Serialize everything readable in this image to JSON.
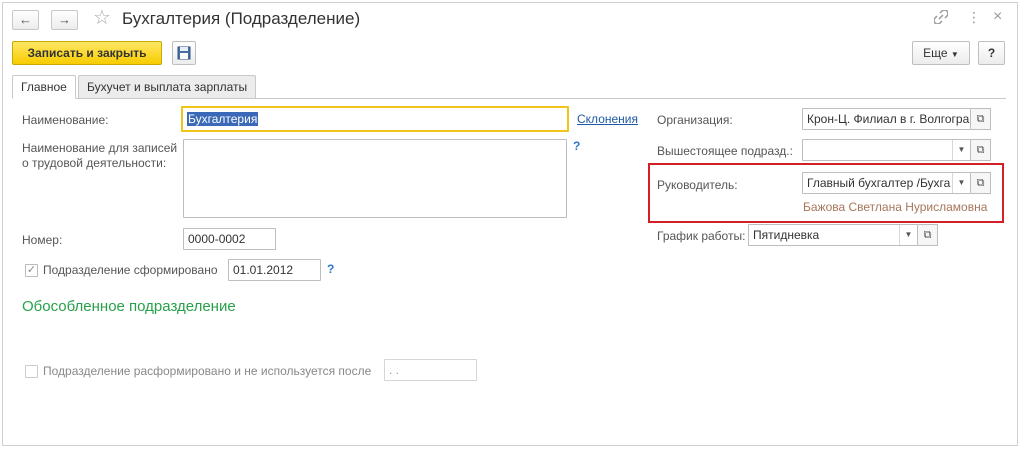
{
  "window": {
    "title": "Бухгалтерия (Подразделение)",
    "back_icon": "←",
    "forward_icon": "→",
    "star_icon": "☆",
    "link_icon": "🔗",
    "menu_icon": "⋮",
    "close_icon": "×"
  },
  "toolbar": {
    "save_close_label": "Записать и закрыть",
    "more_label": "Еще",
    "help_label": "?"
  },
  "tabs": [
    {
      "label": "Главное",
      "active": true
    },
    {
      "label": "Бухучет и выплата зарплаты",
      "active": false
    }
  ],
  "form": {
    "name_label": "Наименование:",
    "name_value": "Бухгалтерия",
    "declensions_link": "Склонения",
    "labor_name_label_line1": "Наименование для записей",
    "labor_name_label_line2": "о трудовой деятельности:",
    "labor_name_value": "",
    "help_q": "?",
    "number_label": "Номер:",
    "number_value": "0000-0002",
    "formed_label": "Подразделение сформировано",
    "formed_checked": true,
    "formed_date": "01.01.2012",
    "separate_unit_label": "Обособленное подразделение",
    "disbanded_label": "Подразделение расформировано и не используется после",
    "disbanded_checked": false,
    "disbanded_date": " .  ."
  },
  "right": {
    "org_label": "Организация:",
    "org_value": "Крон-Ц. Филиал в г. Волгогра",
    "parent_label": "Вышестоящее подразд.:",
    "parent_value": "",
    "head_label": "Руководитель:",
    "head_value": "Главный бухгалтер /Бухга",
    "head_name": "Бажова Светлана Нурисламовна",
    "schedule_label": "График работы:",
    "schedule_value": "Пятидневка"
  },
  "colors": {
    "accent_yellow": "#f7cc00",
    "highlight_red": "#d31f26",
    "link_blue": "#1e5aa8",
    "green": "#27a14a"
  }
}
